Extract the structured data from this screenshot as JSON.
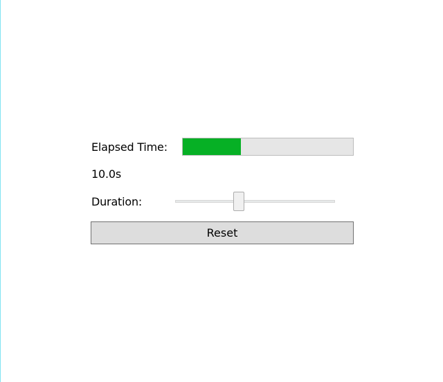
{
  "timer": {
    "elapsed_label": "Elapsed Time:",
    "elapsed_value": "10.0s",
    "elapsed_fraction": 0.34,
    "duration_label": "Duration:",
    "duration_fraction": 0.4,
    "reset_label": "Reset"
  },
  "colors": {
    "progress_fill": "#06b025",
    "progress_track": "#e6e6e6",
    "button_background": "#dddddd"
  }
}
